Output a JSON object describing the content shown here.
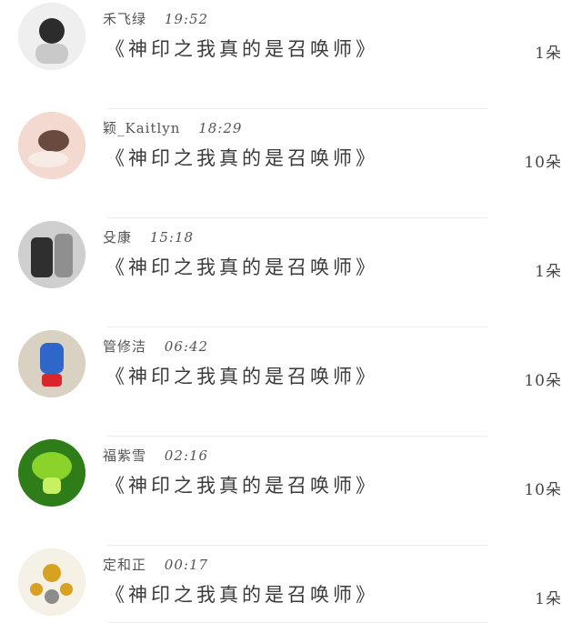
{
  "items": [
    {
      "name": "禾飞绿",
      "time": "19:52",
      "title": "《神印之我真的是召唤师》",
      "count": "1朵",
      "avatar_bg": "#efefef",
      "avatar_fg": "#2c2c2c",
      "avatar_accent": "#c9c9c9"
    },
    {
      "name": "颖_Kaitlyn",
      "time": "18:29",
      "title": "《神印之我真的是召唤师》",
      "count": "10朵",
      "avatar_bg": "#f3d9cf",
      "avatar_fg": "#6a4a3e",
      "avatar_accent": "#f7ebe6"
    },
    {
      "name": "殳康",
      "time": "15:18",
      "title": "《神印之我真的是召唤师》",
      "count": "1朵",
      "avatar_bg": "#cfcfcf",
      "avatar_fg": "#2f2f2f",
      "avatar_accent": "#8f8f8f"
    },
    {
      "name": "管修洁",
      "time": "06:42",
      "title": "《神印之我真的是召唤师》",
      "count": "10朵",
      "avatar_bg": "#d9d2c2",
      "avatar_fg": "#2f66c9",
      "avatar_accent": "#d8262a"
    },
    {
      "name": "福紫雪",
      "time": "02:16",
      "title": "《神印之我真的是召唤师》",
      "count": "10朵",
      "avatar_bg": "#2f7d18",
      "avatar_fg": "#8bd22b",
      "avatar_accent": "#c9ef63"
    },
    {
      "name": "定和正",
      "time": "00:17",
      "title": "《神印之我真的是召唤师》",
      "count": "1朵",
      "avatar_bg": "#f6f1e6",
      "avatar_fg": "#d7a221",
      "avatar_accent": "#8c8c8c"
    }
  ]
}
